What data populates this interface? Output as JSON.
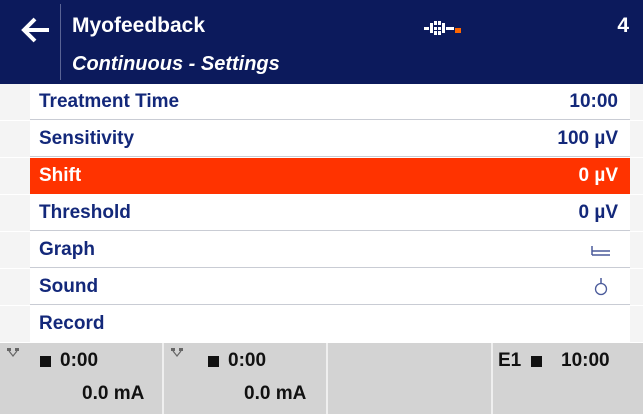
{
  "header": {
    "title": "Myofeedback",
    "subtitle": "Continuous - Settings",
    "page_number": "4",
    "back_icon": "arrow-left-icon",
    "status_icon": "connection-status-icon",
    "colors": {
      "background": "#0c1a5c",
      "text": "#ffffff",
      "status_accent": "#ff6600"
    }
  },
  "settings": {
    "selected_index": 2,
    "colors": {
      "text": "#13287a",
      "selected_background": "#ff3300",
      "selected_text": "#ffffff"
    },
    "items": [
      {
        "label": "Treatment Time",
        "value": "10:00"
      },
      {
        "label": "Sensitivity",
        "value": "100 µV"
      },
      {
        "label": "Shift",
        "value": "0 µV"
      },
      {
        "label": "Threshold",
        "value": "0 µV"
      },
      {
        "label": "Graph",
        "value_icon": "graph-baseline-icon"
      },
      {
        "label": "Sound",
        "value_icon": "sound-indicator-icon"
      },
      {
        "label": "Record"
      }
    ]
  },
  "footer": {
    "channels": [
      {
        "icon": "electrode-icon",
        "status_icon": "stop-icon",
        "time": "0:00",
        "current": "0.0 mA"
      },
      {
        "icon": "electrode-icon",
        "status_icon": "stop-icon",
        "time": "0:00",
        "current": "0.0 mA"
      }
    ],
    "summary": {
      "label": "E1",
      "status_icon": "stop-icon",
      "time": "10:00"
    }
  }
}
